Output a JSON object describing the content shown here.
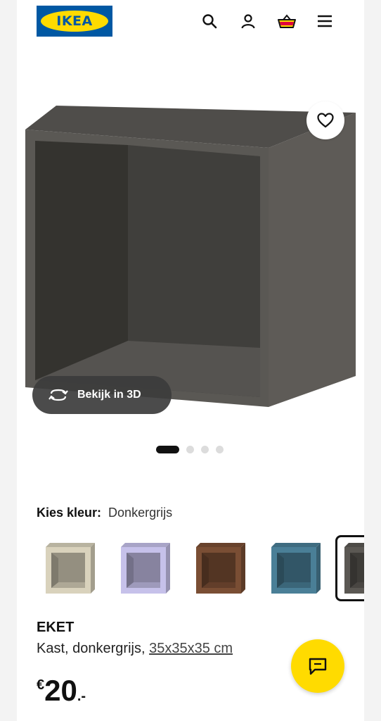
{
  "header": {
    "logo_text": "IKEA",
    "icons": [
      "search-icon",
      "user-icon",
      "basket-icon",
      "menu-icon"
    ]
  },
  "gallery": {
    "view_3d_label": "Bekijk in 3D",
    "dots_total": 4,
    "dots_active": 1
  },
  "colour": {
    "label": "Kies kleur:",
    "value": "Donkergrijs",
    "swatches": [
      "#d9d2bc",
      "#c6c1ea",
      "#7a4e34",
      "#4a7f97",
      "#5b5853"
    ],
    "selected_index": 4
  },
  "product": {
    "name": "EKET",
    "description": "Kast, donkergrijs, ",
    "size": "35x35x35 cm",
    "price_currency": "€",
    "price_integer": "20",
    "price_decimal": ".-"
  },
  "colors": {
    "brand_blue": "#0058a3",
    "brand_yellow": "#ffdb00",
    "cabinet": "#5b5853"
  }
}
